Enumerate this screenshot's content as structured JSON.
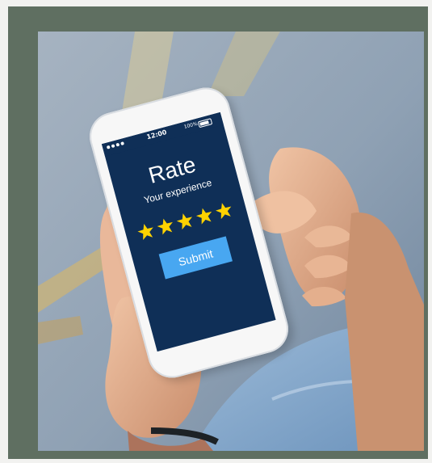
{
  "phone_screen": {
    "status_time": "12:00",
    "battery_percent": "100%",
    "title": "Rate",
    "subtitle": "Your experience",
    "submit_label": "Submit",
    "rating": {
      "value": 5,
      "max": 5
    }
  },
  "colors": {
    "frame": "#5f6f61",
    "screen_background": "#0f2f57",
    "button": "#48a7f1",
    "star": "#ffd200"
  },
  "icons": {
    "signal": "signal-dots-icon",
    "battery": "battery-icon",
    "star": "star-icon"
  }
}
